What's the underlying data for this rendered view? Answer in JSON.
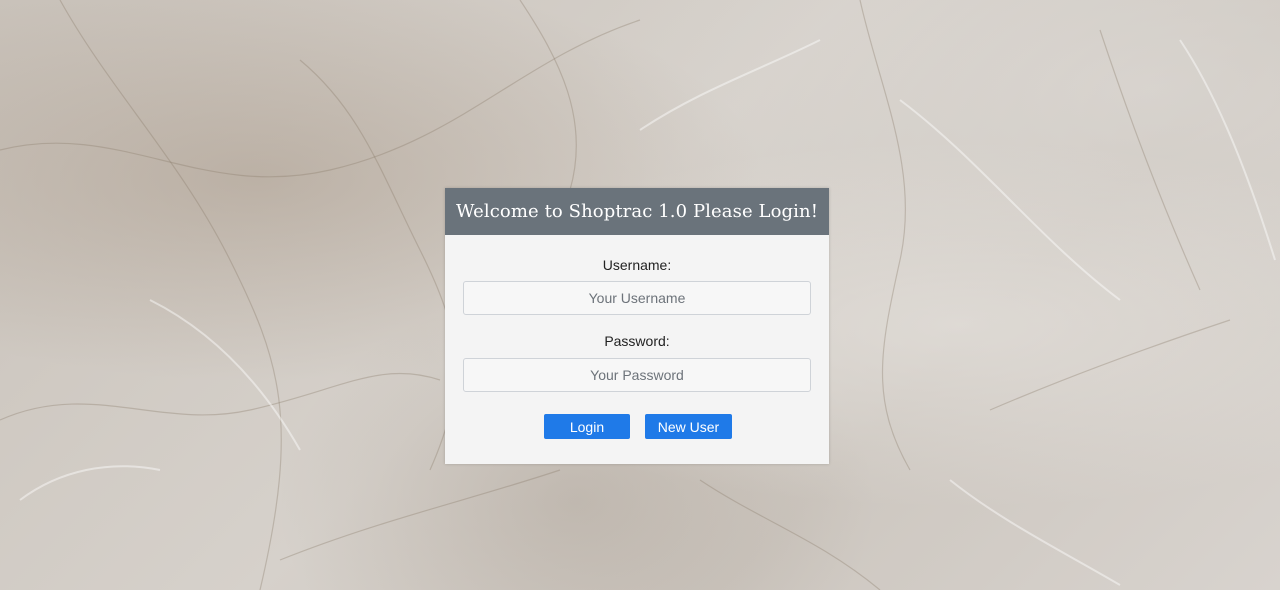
{
  "login": {
    "title": "Welcome to Shoptrac 1.0 Please Login!",
    "username_label": "Username:",
    "username_placeholder": "Your Username",
    "password_label": "Password:",
    "password_placeholder": "Your Password",
    "login_button": "Login",
    "new_user_button": "New User"
  },
  "colors": {
    "header_bg": "#6a737b",
    "card_bg": "#f4f4f4",
    "button_bg": "#1f7ae8",
    "background": "#cbc5bd"
  }
}
